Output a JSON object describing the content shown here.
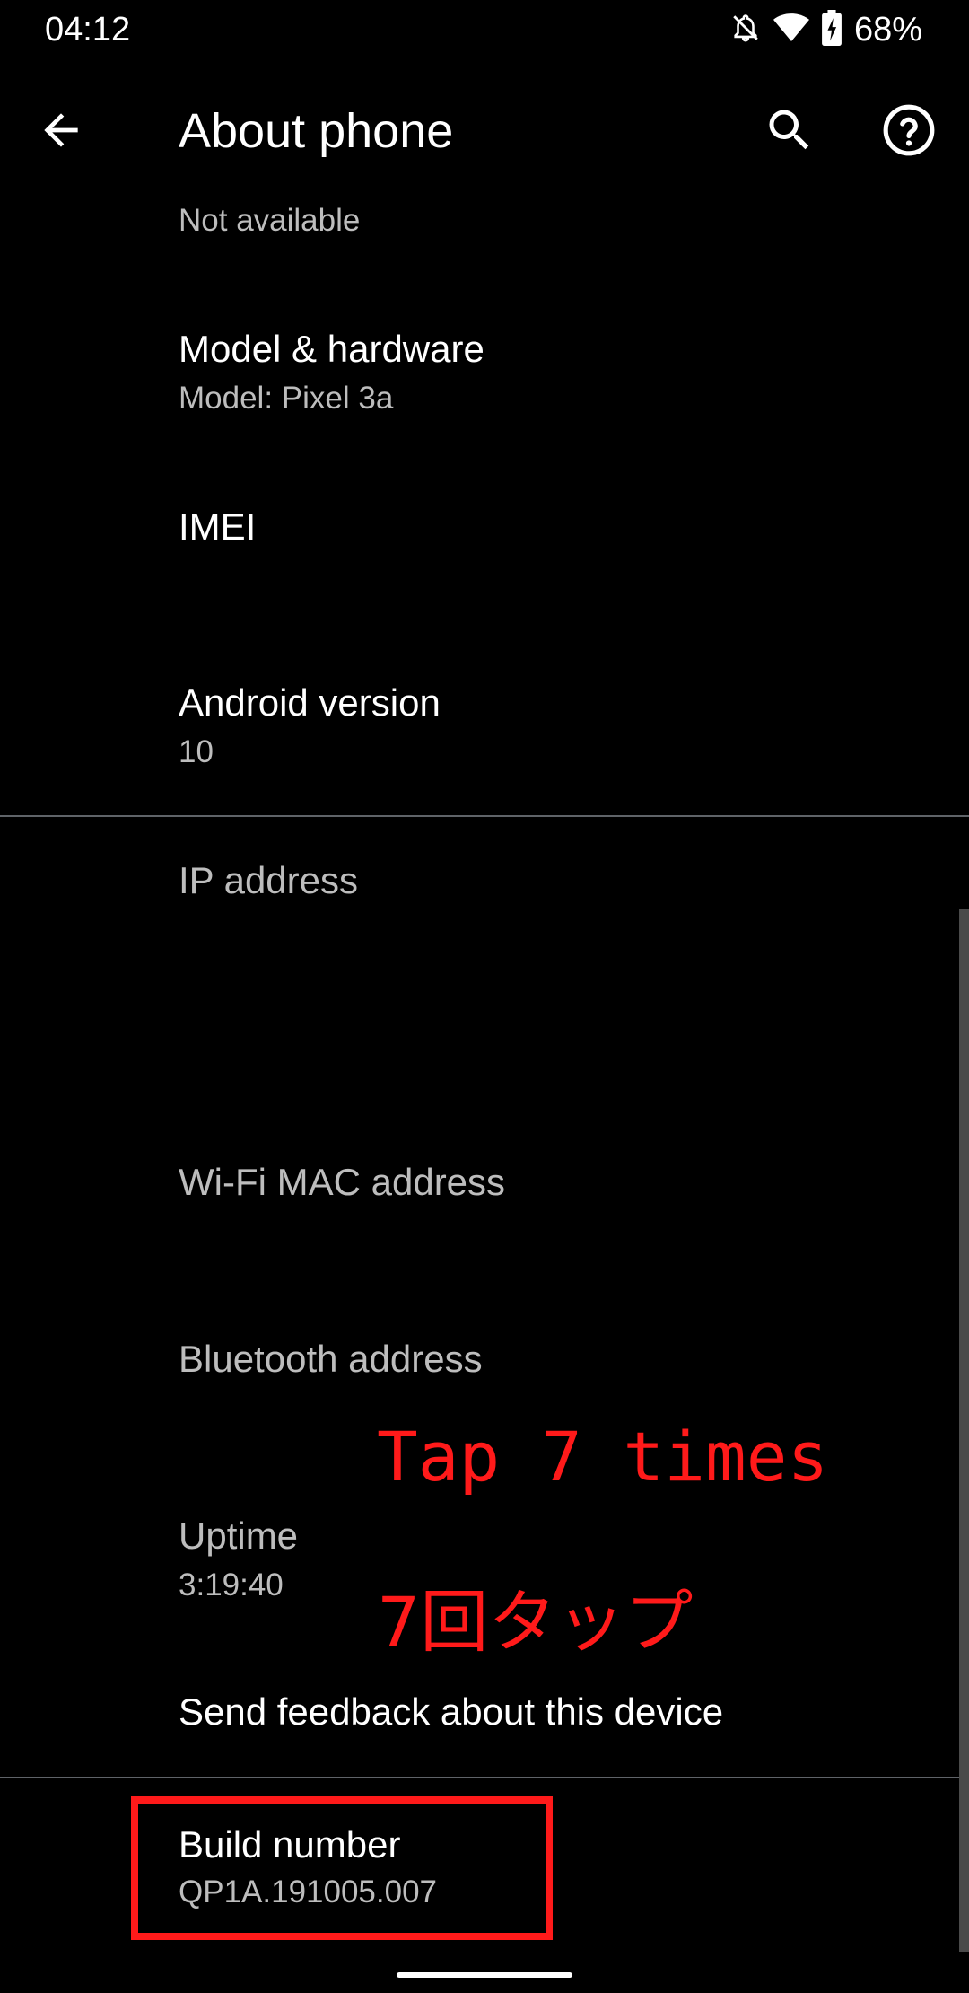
{
  "status_bar": {
    "time": "04:12",
    "battery_percent": "68%",
    "icons": [
      "notifications-off-icon",
      "wifi-icon",
      "battery-charging-icon"
    ]
  },
  "app_bar": {
    "title": "About phone",
    "back_icon": "arrow-back-icon",
    "search_icon": "search-icon",
    "help_icon": "help-icon"
  },
  "prefs": {
    "top_summary": "Not available",
    "model": {
      "title": "Model & hardware",
      "summary": "Model: Pixel 3a"
    },
    "imei": {
      "title": "IMEI"
    },
    "android_version": {
      "title": "Android version",
      "summary": "10"
    },
    "ip_address": {
      "title": "IP address"
    },
    "wifi_mac": {
      "title": "Wi-Fi MAC address"
    },
    "bluetooth": {
      "title": "Bluetooth address"
    },
    "uptime": {
      "title": "Uptime",
      "summary": "3:19:40"
    },
    "feedback": {
      "title": "Send feedback about this device"
    },
    "build_number": {
      "title": "Build number",
      "summary": "QP1A.191005.007"
    }
  },
  "annotations": {
    "tap_en": "Tap 7 times",
    "tap_ja": "7回タップ",
    "color": "#ff1a1a"
  },
  "colors": {
    "background": "#000000",
    "primary_text": "#ffffff",
    "secondary_text": "#bdbdbd",
    "divider": "#5f6368"
  }
}
